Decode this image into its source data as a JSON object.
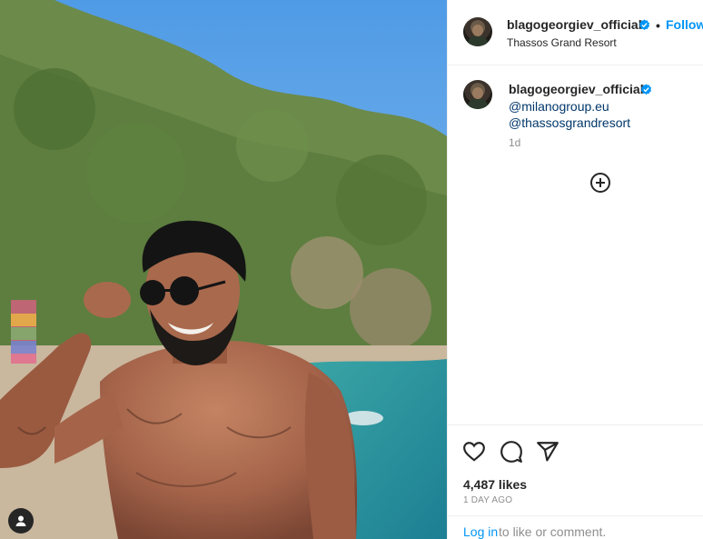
{
  "post": {
    "author": {
      "username": "blagogeorgiev_official",
      "verified": true,
      "location": "Thassos Grand Resort"
    },
    "header": {
      "separator": "•",
      "follow_label": "Follow"
    },
    "caption": {
      "username": "blagogeorgiev_official",
      "mentions": [
        "@milanogroup.eu",
        "@thassosgrandresort"
      ],
      "age": "1d"
    },
    "likes_text": "4,487 likes",
    "date_text": "1 DAY AGO",
    "login_prompt": {
      "link_label": "Log in",
      "rest_text": " to like or comment."
    }
  },
  "icons": {
    "verified": "verified-badge-icon",
    "more": "add-circle-icon",
    "like": "heart-icon",
    "comment": "comment-bubble-icon",
    "share": "paper-plane-icon",
    "tags": "user-tag-icon"
  },
  "colors": {
    "link_blue": "#0095f6",
    "mention_blue": "#00376b",
    "secondary_text": "#8e8e8e",
    "primary_text": "#262626",
    "border": "#efefef"
  }
}
